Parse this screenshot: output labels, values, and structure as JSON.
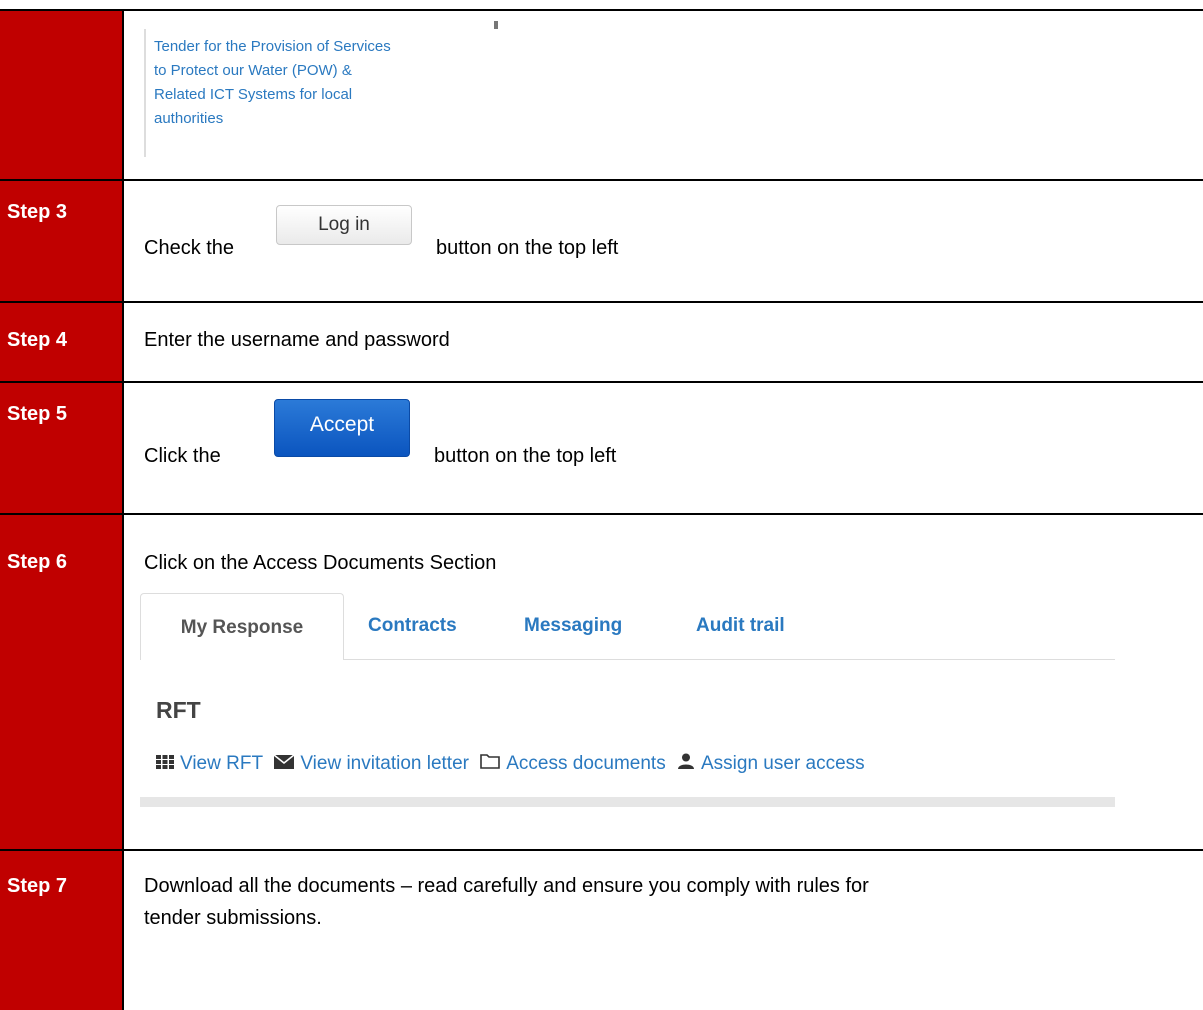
{
  "tender_card": {
    "line1": "Tender for the Provision of Services",
    "line2": "to Protect our Water (POW) &",
    "line3": "Related ICT Systems for local",
    "line4": "authorities"
  },
  "steps": [
    {
      "label": "Step 3",
      "text_before": "Check the",
      "button_label": "Log in",
      "text_after": "button on the top left"
    },
    {
      "label": "Step 4",
      "text": "Enter the username and password"
    },
    {
      "label": "Step 5",
      "text_before": "Click the",
      "button_label": "Accept",
      "text_after": "button on the top left"
    },
    {
      "label": "Step 6",
      "text": "Click on the Access Documents Section"
    },
    {
      "label": "Step 7",
      "line1": "Download all the documents – read carefully and ensure you comply with rules for",
      "line2": "tender submissions."
    }
  ],
  "portal": {
    "tabs": [
      "My Response",
      "Contracts",
      "Messaging",
      "Audit trail"
    ],
    "heading": "RFT",
    "links": [
      "View RFT",
      "View invitation letter",
      "Access documents",
      "Assign user access"
    ]
  }
}
